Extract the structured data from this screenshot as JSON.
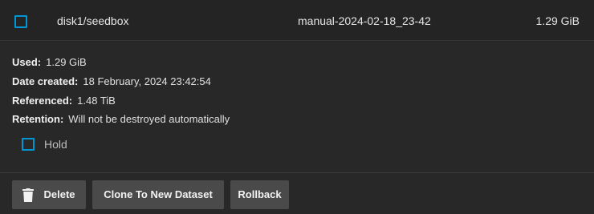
{
  "snapshot_row": {
    "dataset": "disk1/seedbox",
    "snapshot": "manual-2024-02-18_23-42",
    "used": "1.29 GiB"
  },
  "details": {
    "used_label": "Used:",
    "used_value": "1.29 GiB",
    "created_label": "Date created:",
    "created_value": "18 February, 2024 23:42:54",
    "referenced_label": "Referenced:",
    "referenced_value": "1.48 TiB",
    "retention_label": "Retention:",
    "retention_value": "Will not be destroyed automatically"
  },
  "hold": {
    "label": "Hold",
    "checked": false
  },
  "actions": {
    "delete_label": "Delete",
    "clone_label": "Clone To New Dataset",
    "rollback_label": "Rollback"
  },
  "icons": {
    "delete": "trash-icon"
  },
  "colors": {
    "checkbox_accent": "#0095d5",
    "button_bg": "#4a4a4a",
    "background": "#282828"
  }
}
